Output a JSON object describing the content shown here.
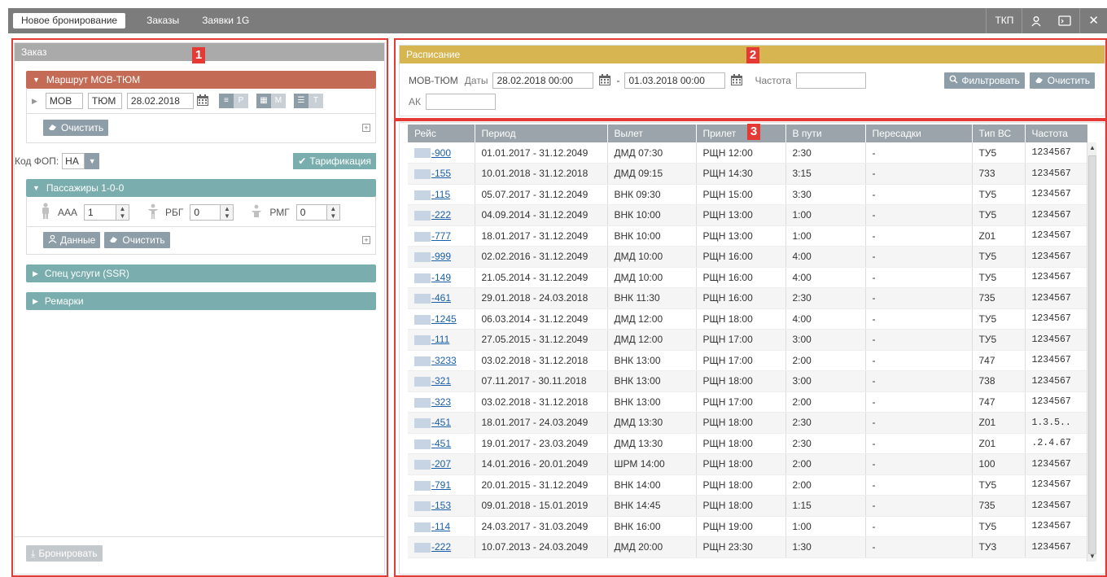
{
  "topbar": {
    "tabs": [
      "Новое бронирование",
      "Заказы",
      "Заявки 1G"
    ],
    "right_label": "ТКП",
    "user_icon": "user-icon",
    "terminal_icon": "terminal-icon",
    "close_icon": "close-icon"
  },
  "annotations": [
    "1",
    "2",
    "3"
  ],
  "order": {
    "title": "Заказ",
    "route": {
      "header": "Маршрут МОВ-ТЮМ",
      "from": "МОВ",
      "to": "ТЮМ",
      "date": "28.02.2018",
      "btn_p": "Р",
      "btn_m": "М",
      "btn_t": "Т",
      "clear": "Очистить"
    },
    "fop_label": "Код ФОП:",
    "fop_value": "НА",
    "tarif_button": "Тарификация",
    "passengers": {
      "header": "Пассажиры 1-0-0",
      "adult_label": "ААА",
      "adult_value": "1",
      "child_label": "РБГ",
      "child_value": "0",
      "infant_label": "РМГ",
      "infant_value": "0",
      "data_button": "Данные",
      "clear": "Очистить"
    },
    "ssr_header": "Спец услуги (SSR)",
    "remarks_header": "Ремарки",
    "book_button": "Бронировать"
  },
  "schedule": {
    "title": "Расписание",
    "route": "МОВ-ТЮМ",
    "dates_label": "Даты",
    "date_from": "28.02.2018 00:00",
    "date_sep": "-",
    "date_to": "01.03.2018 00:00",
    "freq_label": "Частота",
    "freq_value": "",
    "ak_label": "АК",
    "ak_value": "",
    "filter_button": "Фильтровать",
    "clear_button": "Очистить"
  },
  "grid": {
    "columns": [
      "Рейс",
      "Период",
      "Вылет",
      "Прилет",
      "В пути",
      "Пересадки",
      "Тип ВС",
      "Частота"
    ],
    "rows": [
      [
        "-900",
        "01.01.2017 - 31.12.2049",
        "ДМД 07:30",
        "РЩН 12:00",
        "2:30",
        "-",
        "ТУ5",
        "1234567"
      ],
      [
        "-155",
        "10.01.2018 - 31.12.2018",
        "ДМД 09:15",
        "РЩН 14:30",
        "3:15",
        "-",
        "733",
        "1234567"
      ],
      [
        "-115",
        "05.07.2017 - 31.12.2049",
        "ВНК 09:30",
        "РЩН 15:00",
        "3:30",
        "-",
        "ТУ5",
        "1234567"
      ],
      [
        "-222",
        "04.09.2014 - 31.12.2049",
        "ВНК 10:00",
        "РЩН 13:00",
        "1:00",
        "-",
        "ТУ5",
        "1234567"
      ],
      [
        "-777",
        "18.01.2017 - 31.12.2049",
        "ВНК 10:00",
        "РЩН 13:00",
        "1:00",
        "-",
        "Z01",
        "1234567"
      ],
      [
        "-999",
        "02.02.2016 - 31.12.2049",
        "ДМД 10:00",
        "РЩН 16:00",
        "4:00",
        "-",
        "ТУ5",
        "1234567"
      ],
      [
        "-149",
        "21.05.2014 - 31.12.2049",
        "ДМД 10:00",
        "РЩН 16:00",
        "4:00",
        "-",
        "ТУ5",
        "1234567"
      ],
      [
        "-461",
        "29.01.2018 - 24.03.2018",
        "ВНК 11:30",
        "РЩН 16:00",
        "2:30",
        "-",
        "735",
        "1234567"
      ],
      [
        "-1245",
        "06.03.2014 - 31.12.2049",
        "ДМД 12:00",
        "РЩН 18:00",
        "4:00",
        "-",
        "ТУ5",
        "1234567"
      ],
      [
        "-111",
        "27.05.2015 - 31.12.2049",
        "ДМД 12:00",
        "РЩН 17:00",
        "3:00",
        "-",
        "ТУ5",
        "1234567"
      ],
      [
        "-3233",
        "03.02.2018 - 31.12.2018",
        "ВНК 13:00",
        "РЩН 17:00",
        "2:00",
        "-",
        "747",
        "1234567"
      ],
      [
        "-321",
        "07.11.2017 - 30.11.2018",
        "ВНК 13:00",
        "РЩН 18:00",
        "3:00",
        "-",
        "738",
        "1234567"
      ],
      [
        "-323",
        "03.02.2018 - 31.12.2018",
        "ВНК 13:00",
        "РЩН 17:00",
        "2:00",
        "-",
        "747",
        "1234567"
      ],
      [
        "-451",
        "18.01.2017 - 24.03.2049",
        "ДМД 13:30",
        "РЩН 18:00",
        "2:30",
        "-",
        "Z01",
        "1.3.5.."
      ],
      [
        "-451",
        "19.01.2017 - 23.03.2049",
        "ДМД 13:30",
        "РЩН 18:00",
        "2:30",
        "-",
        "Z01",
        ".2.4.67"
      ],
      [
        "-207",
        "14.01.2016 - 20.01.2049",
        "ШРМ 14:00",
        "РЩН 18:00",
        "2:00",
        "-",
        "100",
        "1234567"
      ],
      [
        "-791",
        "20.01.2015 - 31.12.2049",
        "ВНК 14:00",
        "РЩН 18:00",
        "2:00",
        "-",
        "ТУ5",
        "1234567"
      ],
      [
        "-153",
        "09.01.2018 - 15.01.2019",
        "ВНК 14:45",
        "РЩН 18:00",
        "1:15",
        "-",
        "735",
        "1234567"
      ],
      [
        "-114",
        "24.03.2017 - 31.03.2049",
        "ВНК 16:00",
        "РЩН 19:00",
        "1:00",
        "-",
        "ТУ5",
        "1234567"
      ],
      [
        "-222",
        "10.07.2013 - 24.03.2049",
        "ДМД 20:00",
        "РЩН 23:30",
        "1:30",
        "-",
        "ТУ3",
        "1234567"
      ]
    ]
  }
}
